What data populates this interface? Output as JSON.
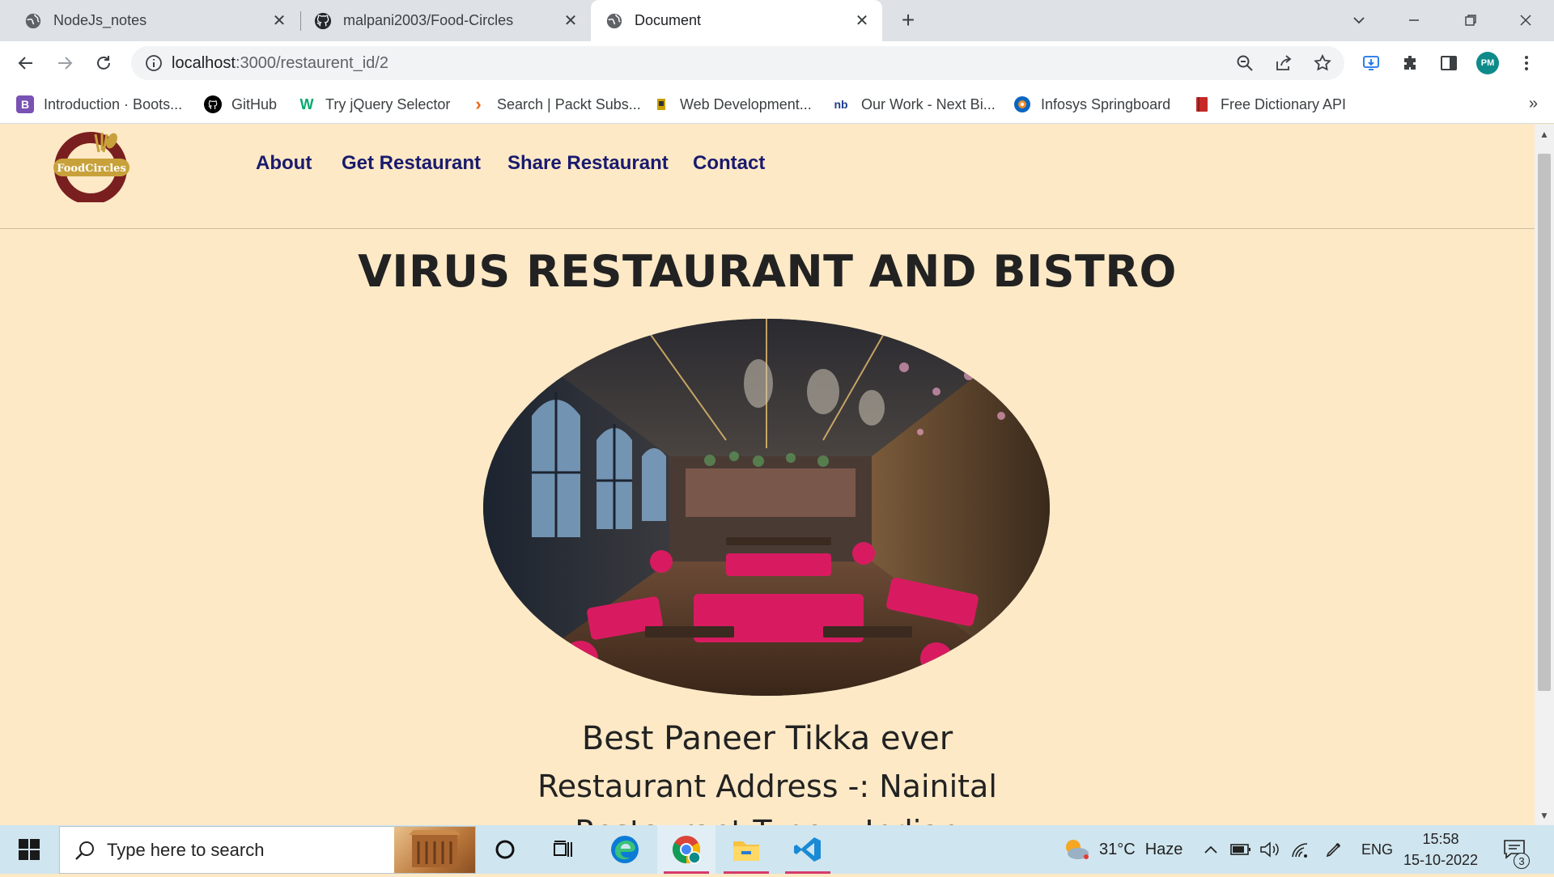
{
  "browser": {
    "tabs": [
      {
        "title": "NodeJs_notes",
        "icon": "globe-icon",
        "active": false
      },
      {
        "title": "malpani2003/Food-Circles",
        "icon": "github-icon",
        "active": false
      },
      {
        "title": "Document",
        "icon": "globe-icon",
        "active": true
      }
    ],
    "new_tab_label": "+",
    "address": {
      "host": "localhost",
      "path": ":3000/restaurent_id/2"
    },
    "profile_initials": "PM",
    "bookmarks": [
      {
        "label": "Introduction · Boots...",
        "icon": "bootstrap-icon",
        "color": "#7952b3",
        "glyph": "B"
      },
      {
        "label": "GitHub",
        "icon": "github-icon",
        "color": "#000000",
        "glyph": ""
      },
      {
        "label": "Try jQuery Selector",
        "icon": "w3schools-icon",
        "color": "#04aa6d",
        "glyph": "W"
      },
      {
        "label": "Search | Packt Subs...",
        "icon": "packt-icon",
        "color": "#ec6611",
        "glyph": ">"
      },
      {
        "label": "Web Development...",
        "icon": "bookmark-icon",
        "color": "#c8a100",
        "glyph": ""
      },
      {
        "label": "Our Work - Next Bi...",
        "icon": "nb-icon",
        "color": "#1e3f8a",
        "glyph": "nb"
      },
      {
        "label": "Infosys Springboard",
        "icon": "infosys-icon",
        "color": "#0a66c2",
        "glyph": ""
      },
      {
        "label": "Free Dictionary API",
        "icon": "dictionary-icon",
        "color": "#c62828",
        "glyph": ""
      }
    ],
    "bookmarks_more": "»"
  },
  "site": {
    "logo_text": "FoodCircles",
    "nav": [
      "About",
      "Get Restaurant",
      "Share Restaurant",
      "Contact"
    ],
    "restaurant": {
      "name": "VIRUS RESTAURANT AND BISTRO",
      "tagline": "Best Paneer Tikka ever",
      "address": "Restaurant Address -: Nainital",
      "type": "Restaurant Type -: Indian"
    },
    "colors": {
      "background": "#fde9c6",
      "nav": "#1a1a6e",
      "accent": "#c8a13a",
      "logo_ring": "#7a1f1f"
    }
  },
  "taskbar": {
    "search_placeholder": "Type here to search",
    "weather": {
      "temp": "31°C",
      "condition": "Haze"
    },
    "language": "ENG",
    "time": "15:58",
    "date": "15-10-2022",
    "notification_count": "3"
  }
}
